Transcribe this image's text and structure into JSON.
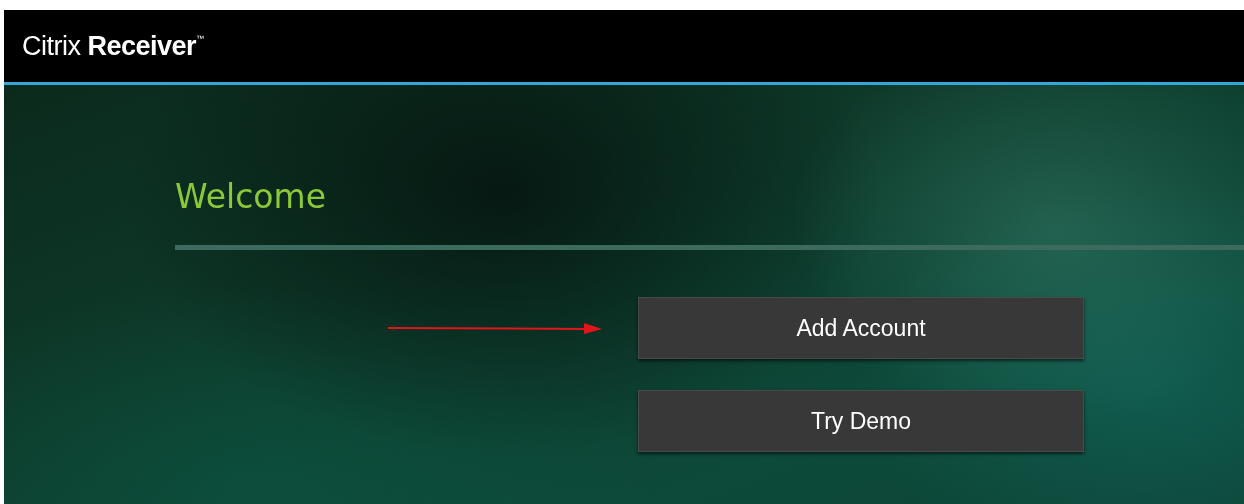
{
  "header": {
    "logo": "Citrix **Receiver**$^{™}$"
  },
  "welcome": {
    "title": "Welcome"
  },
  "buttons": [
    {
      "label": "Add Account"
    },
    {
      "label": "Try Demo"
    }
  ]
}
